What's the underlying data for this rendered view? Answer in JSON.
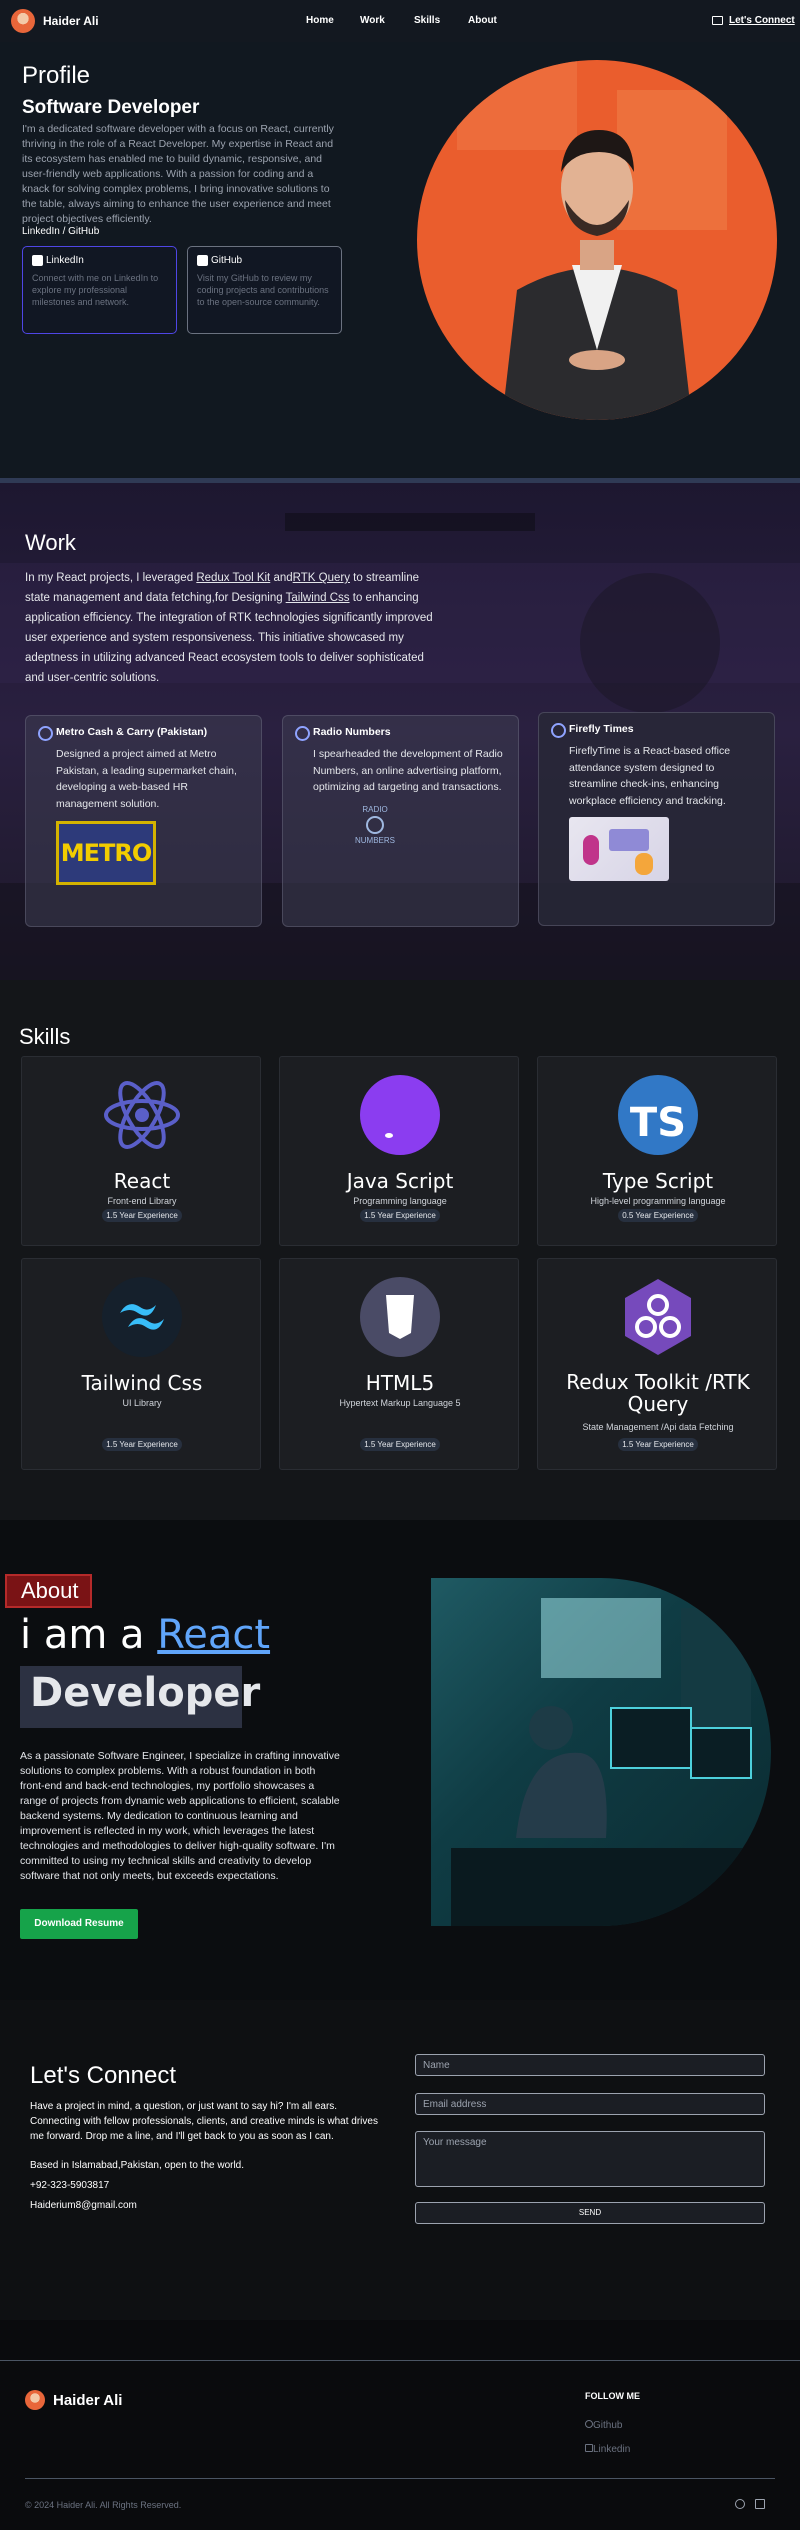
{
  "nav": {
    "brand": "Haider Ali",
    "links": [
      "Home",
      "Work",
      "Skills",
      "About"
    ],
    "cta": "Let's Connect"
  },
  "hero": {
    "title": "Profile",
    "subtitle": "Software Developer",
    "paragraph": "I'm a dedicated software developer with a focus on React, currently thriving in the role of a React Developer. My expertise in React and its ecosystem has enabled me to build dynamic, responsive, and user-friendly web applications. With a passion for coding and a knack for solving complex problems, I bring innovative solutions to the table, always aiming to enhance the user experience and meet project objectives efficiently.",
    "links_label": "LinkedIn / GitHub",
    "cards": [
      {
        "title": "LinkedIn",
        "desc": "Connect with me on LinkedIn to explore my professional milestones and network."
      },
      {
        "title": "GitHub",
        "desc": "Visit my GitHub to review my coding projects and contributions to the open-source community."
      }
    ]
  },
  "work": {
    "title": "Work",
    "p_1": "In my React projects, I leveraged ",
    "p_link1": "Redux Tool Kit",
    "p_2": " and",
    "p_link2": "RTK Query",
    "p_3": " to streamline state management and data fetching,for Designing ",
    "p_link3": "Tailwind Css",
    "p_4": " to enhancing application efficiency. The integration of RTK technologies significantly improved user experience and system responsiveness. This initiative showcased my adeptness in utilizing advanced React ecosystem tools to deliver sophisticated and user-centric solutions.",
    "projects": [
      {
        "title": "Metro Cash & Carry (Pakistan)",
        "desc": "Designed a project aimed at Metro Pakistan, a leading supermarket chain, developing a web-based HR management solution.",
        "logo_text": "METRO"
      },
      {
        "title": "Radio Numbers",
        "desc": "I spearheaded the development of Radio Numbers, an online advertising platform, optimizing ad targeting and transactions.",
        "logo_text_top": "RADIO",
        "logo_text_bottom": "NUMBERS"
      },
      {
        "title": "Firefly Times",
        "desc": "FireflyTime is a React-based office attendance system designed to streamline check-ins, enhancing workplace efficiency and tracking."
      }
    ]
  },
  "skills": {
    "title": "Skills",
    "items": [
      {
        "name": "React",
        "category": "Front-end Library",
        "badge": "1.5 Year Experience",
        "icon": "react-icon",
        "color": "#5a5fc9"
      },
      {
        "name": "Java Script",
        "category": "Programming language",
        "badge": "1.5 Year Experience",
        "icon": "javascript-icon",
        "color": "#8b3df0"
      },
      {
        "name": "Type Script",
        "category": "High-level programming language",
        "badge": "0.5 Year Experience",
        "icon": "typescript-icon",
        "color": "#3178c6",
        "icon_text": "TS"
      },
      {
        "name": "Tailwind Css",
        "category": "UI Library",
        "badge": "1.5 Year Experience",
        "icon": "tailwind-icon",
        "color": "#38bdf8"
      },
      {
        "name": "HTML5",
        "category": "Hypertext Markup Language 5",
        "badge": "1.5 Year Experience",
        "icon": "html5-icon",
        "color": "#4a4b66"
      },
      {
        "name": "Redux Toolkit /RTK Query",
        "category": "State Management /Api data Fetching",
        "badge": "1.5 Year Experience",
        "icon": "redux-icon",
        "color": "#764abc"
      }
    ]
  },
  "about": {
    "tag": "About",
    "h1_pre": "i am a ",
    "h1_hl": "React",
    "h1_dev": "Developer",
    "paragraph": "As a passionate Software Engineer, I specialize in crafting innovative solutions to complex problems. With a robust foundation in both front-end and back-end technologies, my portfolio showcases a range of projects from dynamic web applications to efficient, scalable backend systems. My dedication to continuous learning and improvement is reflected in my work, which leverages the latest technologies and methodologies to deliver high-quality software. I'm committed to using my technical skills and creativity to develop software that not only meets, but exceeds expectations.",
    "button": "Download Resume"
  },
  "connect": {
    "title": "Let's Connect",
    "paragraph": "Have a project in mind, a question, or just want to say hi? I'm all ears. Connecting with fellow professionals, clients, and creative minds is what drives me forward. Drop me a line, and I'll get back to you as soon as I can.",
    "location": "Based in Islamabad,Pakistan, open to the world.",
    "phone": "+92-323-5903817",
    "email": "Haiderium8@gmail.com",
    "name_ph": "Name",
    "email_ph": "Email address",
    "msg_ph": "Your message",
    "send": "SEND"
  },
  "footer": {
    "brand": "Haider Ali",
    "follow": "FOLLOW ME",
    "links": [
      "Github",
      "Linkedin"
    ],
    "copyright": "© 2024 Haider Ali. All Rights Reserved."
  },
  "colors": {
    "accent_orange": "#ea5d2d",
    "accent_blue": "#60a5fa",
    "button_green": "#16a34a"
  }
}
